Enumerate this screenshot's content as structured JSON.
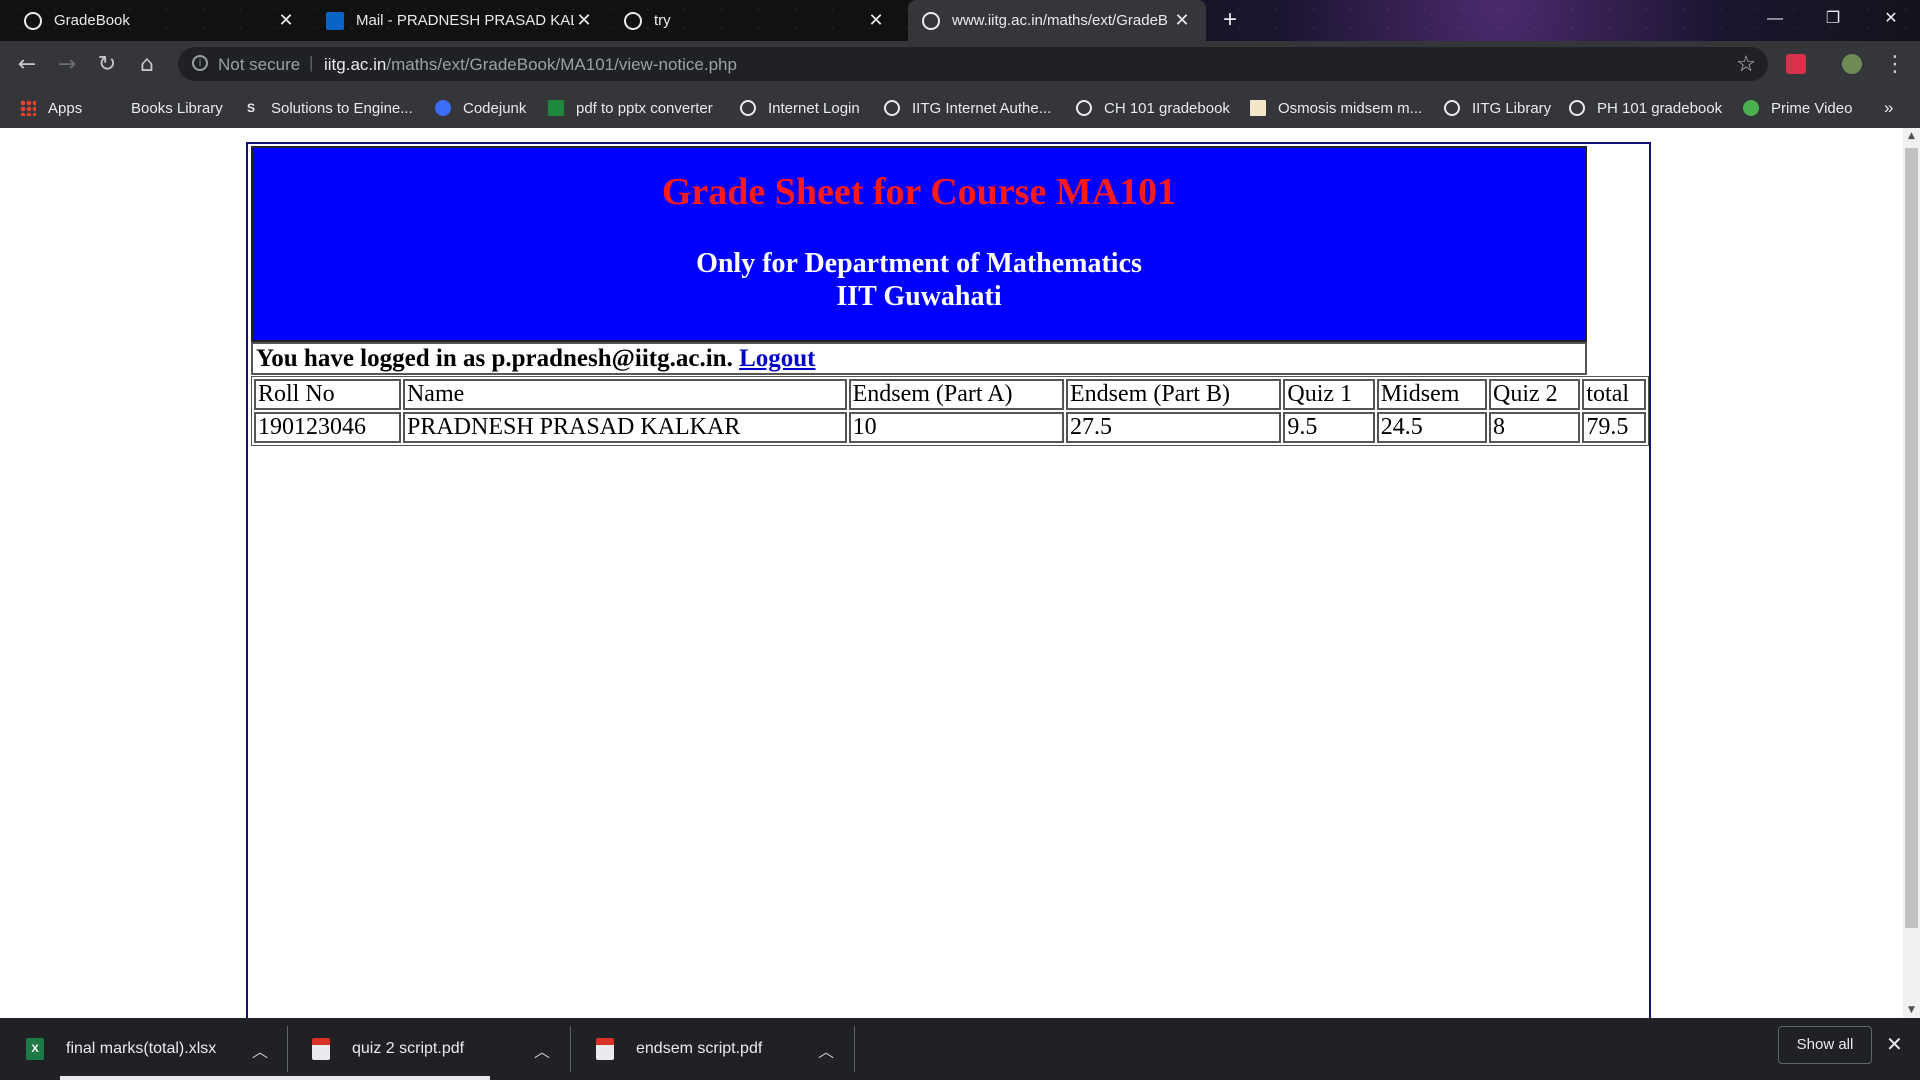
{
  "tabs": [
    {
      "title": "GradeBook",
      "icon": "globe-icon"
    },
    {
      "title": "Mail - PRADNESH PRASAD KALK",
      "icon": "outlook-icon"
    },
    {
      "title": "try",
      "icon": "globe-icon"
    },
    {
      "title": "www.iitg.ac.in/maths/ext/GradeB",
      "icon": "globe-icon",
      "active": true
    }
  ],
  "new_tab_label": "+",
  "window_controls": {
    "minimize": "—",
    "restore": "❐",
    "close": "✕"
  },
  "address_bar": {
    "security_label": "Not secure",
    "separator": "|",
    "url_host": "iitg.ac.in",
    "url_path": "/maths/ext/GradeBook/MA101/view-notice.php"
  },
  "bookmarks": [
    "Apps",
    "Books Library",
    "Solutions to Engine...",
    "Codejunk",
    "pdf to pptx converter",
    "Internet Login",
    "IITG Internet Authe...",
    "CH 101 gradebook",
    "Osmosis midsem m...",
    "IITG Library",
    "PH 101 gradebook",
    "Prime Video"
  ],
  "bookmarks_overflow": "»",
  "page": {
    "title": "Grade Sheet for Course MA101",
    "subtitle_line1": "Only for Department of Mathematics",
    "subtitle_line2": "IIT Guwahati",
    "login_prefix": "You have logged in as p.pradnesh@iitg.ac.in.",
    "logout_label": "Logout",
    "table": {
      "headers": [
        "Roll No",
        "Name",
        "Endsem (Part A)",
        "Endsem (Part B)",
        "Quiz 1",
        "Midsem",
        "Quiz 2",
        "total"
      ],
      "rows": [
        [
          "190123046",
          "PRADNESH PRASAD KALKAR",
          "10",
          "27.5",
          "9.5",
          "24.5",
          "8",
          "79.5"
        ]
      ]
    }
  },
  "downloads": [
    {
      "name": "final marks(total).xlsx",
      "type": "xlsx"
    },
    {
      "name": "quiz 2 script.pdf",
      "type": "pdf"
    },
    {
      "name": "endsem script.pdf",
      "type": "pdf"
    }
  ],
  "downloads_show_all": "Show all",
  "downloads_close": "✕"
}
